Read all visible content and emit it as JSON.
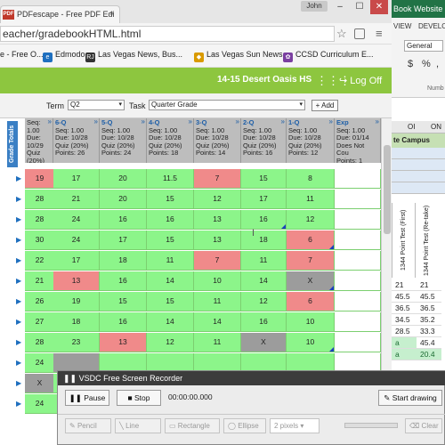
{
  "browser": {
    "tab_title": "PDFescape - Free PDF Edi",
    "tab_close": "×",
    "pdf_icon": "PDF",
    "user": "John",
    "url": "eacher/gradebookHTML.html",
    "min_icon": "–",
    "max_icon": "☐",
    "close_icon": "✕",
    "star_icon": "☆",
    "menu_icon": "≡",
    "bookmarks": [
      {
        "label": "e - Free O...",
        "icon": "",
        "color": "#1e5fa8"
      },
      {
        "label": "Edmodo",
        "icon": "e",
        "color": "#1e6fbf"
      },
      {
        "label": "Las Vegas News, Bus...",
        "icon": "RJ",
        "color": "#333333"
      },
      {
        "label": "Las Vegas Sun News",
        "icon": "◆",
        "color": "#d99a00"
      },
      {
        "label": "CCSD Curriculum E...",
        "icon": "✿",
        "color": "#7a3fa0"
      }
    ]
  },
  "app": {
    "school": "14-15 Desert Oasis HS",
    "grid_icon": "⋮⋮⋮",
    "logoff": "Log Off",
    "logoff_icon": "↪",
    "term_label": "Term",
    "term_value": "Q2",
    "task_label": "Task",
    "task_value": "Quarter Grade",
    "add_label": "+ Add",
    "grade_totals": "Grade Totals",
    "columns": [
      {
        "code": "",
        "lines": [
          "Seq: 1.00",
          "Due: 10/29",
          "Quiz (20%)",
          "Points: 32"
        ]
      },
      {
        "code": "6-Q",
        "lines": [
          "Seq: 1.00",
          "Due: 10/28",
          "Quiz (20%)",
          "Points: 26"
        ]
      },
      {
        "code": "5-Q",
        "lines": [
          "Seq: 1.00",
          "Due: 10/28",
          "Quiz (20%)",
          "Points: 24"
        ]
      },
      {
        "code": "4-Q",
        "lines": [
          "Seq: 1.00",
          "Due: 10/28",
          "Quiz (20%)",
          "Points: 18"
        ]
      },
      {
        "code": "3-Q",
        "lines": [
          "Seq: 1.00",
          "Due: 10/28",
          "Quiz (20%)",
          "Points: 14"
        ]
      },
      {
        "code": "2-Q",
        "lines": [
          "Seq: 1.00",
          "Due: 10/28",
          "Quiz (20%)",
          "Points: 16"
        ]
      },
      {
        "code": "1-Q",
        "lines": [
          "Seq: 1.00",
          "Due: 10/28",
          "Quiz (20%)",
          "Points: 12"
        ]
      },
      {
        "code": "Exp",
        "lines": [
          "Seq: 1.00",
          "Due: 01/14",
          "Does Not Cou",
          "Points: 1"
        ]
      }
    ],
    "rows": [
      {
        "total": "19",
        "t": "r",
        "cells": [
          [
            "17",
            "g",
            0
          ],
          [
            "20",
            "g",
            0
          ],
          [
            "11.5",
            "g",
            0
          ],
          [
            "7",
            "r",
            0
          ],
          [
            "15",
            "g",
            0
          ],
          [
            "8",
            "g",
            0
          ]
        ]
      },
      {
        "total": "28",
        "t": "g",
        "cells": [
          [
            "21",
            "g",
            0
          ],
          [
            "20",
            "g",
            0
          ],
          [
            "15",
            "g",
            0
          ],
          [
            "12",
            "g",
            0
          ],
          [
            "17",
            "g",
            0
          ],
          [
            "11",
            "g",
            0
          ]
        ]
      },
      {
        "total": "28",
        "t": "g",
        "cells": [
          [
            "24",
            "g",
            0
          ],
          [
            "16",
            "g",
            0
          ],
          [
            "16",
            "g",
            0
          ],
          [
            "13",
            "g",
            0
          ],
          [
            "16",
            "g",
            1
          ],
          [
            "12",
            "g",
            0
          ]
        ]
      },
      {
        "total": "30",
        "t": "g",
        "cells": [
          [
            "24",
            "g",
            0
          ],
          [
            "17",
            "g",
            0
          ],
          [
            "15",
            "g",
            0
          ],
          [
            "13",
            "g",
            0
          ],
          [
            "18",
            "g",
            0
          ],
          [
            "6",
            "r",
            1
          ]
        ]
      },
      {
        "total": "22",
        "t": "g",
        "cells": [
          [
            "17",
            "g",
            0
          ],
          [
            "18",
            "g",
            0
          ],
          [
            "11",
            "g",
            0
          ],
          [
            "7",
            "r",
            0
          ],
          [
            "11",
            "g",
            0
          ],
          [
            "7",
            "r",
            0
          ]
        ]
      },
      {
        "total": "21",
        "t": "g",
        "cells": [
          [
            "13",
            "r",
            0
          ],
          [
            "16",
            "g",
            0
          ],
          [
            "14",
            "g",
            0
          ],
          [
            "10",
            "g",
            0
          ],
          [
            "14",
            "g",
            0
          ],
          [
            "X",
            "x",
            1
          ]
        ]
      },
      {
        "total": "26",
        "t": "g",
        "cells": [
          [
            "19",
            "g",
            0
          ],
          [
            "15",
            "g",
            0
          ],
          [
            "15",
            "g",
            0
          ],
          [
            "11",
            "g",
            0
          ],
          [
            "12",
            "g",
            0
          ],
          [
            "6",
            "r",
            0
          ]
        ]
      },
      {
        "total": "27",
        "t": "g",
        "cells": [
          [
            "18",
            "g",
            0
          ],
          [
            "16",
            "g",
            0
          ],
          [
            "14",
            "g",
            0
          ],
          [
            "14",
            "g",
            0
          ],
          [
            "16",
            "g",
            0
          ],
          [
            "10",
            "g",
            0
          ]
        ]
      },
      {
        "total": "28",
        "t": "g",
        "cells": [
          [
            "23",
            "g",
            0
          ],
          [
            "13",
            "r",
            0
          ],
          [
            "12",
            "g",
            0
          ],
          [
            "11",
            "g",
            0
          ],
          [
            "X",
            "x",
            0
          ],
          [
            "10",
            "g",
            1
          ]
        ]
      },
      {
        "total": "24",
        "t": "g",
        "cells": [
          [
            "",
            "x",
            0
          ],
          [
            "",
            "g",
            0
          ],
          [
            "",
            "g",
            0
          ],
          [
            "",
            "g",
            0
          ],
          [
            "",
            "g",
            0
          ],
          [
            "",
            "g",
            0
          ]
        ]
      },
      {
        "total": "X",
        "t": "x",
        "cells": [
          [
            "",
            "g",
            0
          ],
          [
            "",
            "g",
            0
          ],
          [
            "",
            "g",
            0
          ],
          [
            "",
            "g",
            0
          ],
          [
            "",
            "g",
            0
          ],
          [
            "",
            "g",
            0
          ]
        ]
      },
      {
        "total": "24",
        "t": "g",
        "cells": [
          [
            "",
            "g",
            0
          ],
          [
            "",
            "g",
            0
          ],
          [
            "",
            "g",
            0
          ],
          [
            "",
            "g",
            0
          ],
          [
            "",
            "g",
            0
          ],
          [
            "",
            "g",
            0
          ]
        ]
      }
    ]
  },
  "excel": {
    "title": "Book Website I",
    "tabs": [
      "VIEW",
      "DEVELO"
    ],
    "number_format": "General",
    "dollar": "$",
    "percent": "%",
    "comma": ",",
    "number_label": "Numb",
    "col_headers": [
      "OI",
      "ON"
    ],
    "campus": "te Campus",
    "vert_header_1": "1344 Point Test (First)",
    "vert_header_2": "1344 Point Test (Re-take)",
    "values": [
      [
        "21",
        "21"
      ],
      [
        "45.5",
        "45.5"
      ],
      [
        "36.5",
        "36.5"
      ],
      [
        "34.5",
        "35.2"
      ],
      [
        "28.5",
        "33.3"
      ],
      [
        "a",
        "45.4"
      ],
      [
        "a",
        "20.4"
      ]
    ]
  },
  "recorder": {
    "title": "VSDC Free Screen Recorder",
    "title_icon": "❚❚",
    "pause": "Pause",
    "stop": "Stop",
    "time": "00:00:00.000",
    "start_drawing": "Start drawing",
    "tools": [
      "Pencil",
      "Line",
      "Rectangle",
      "Ellipse",
      "2 pixels"
    ],
    "clear": "Clear"
  }
}
